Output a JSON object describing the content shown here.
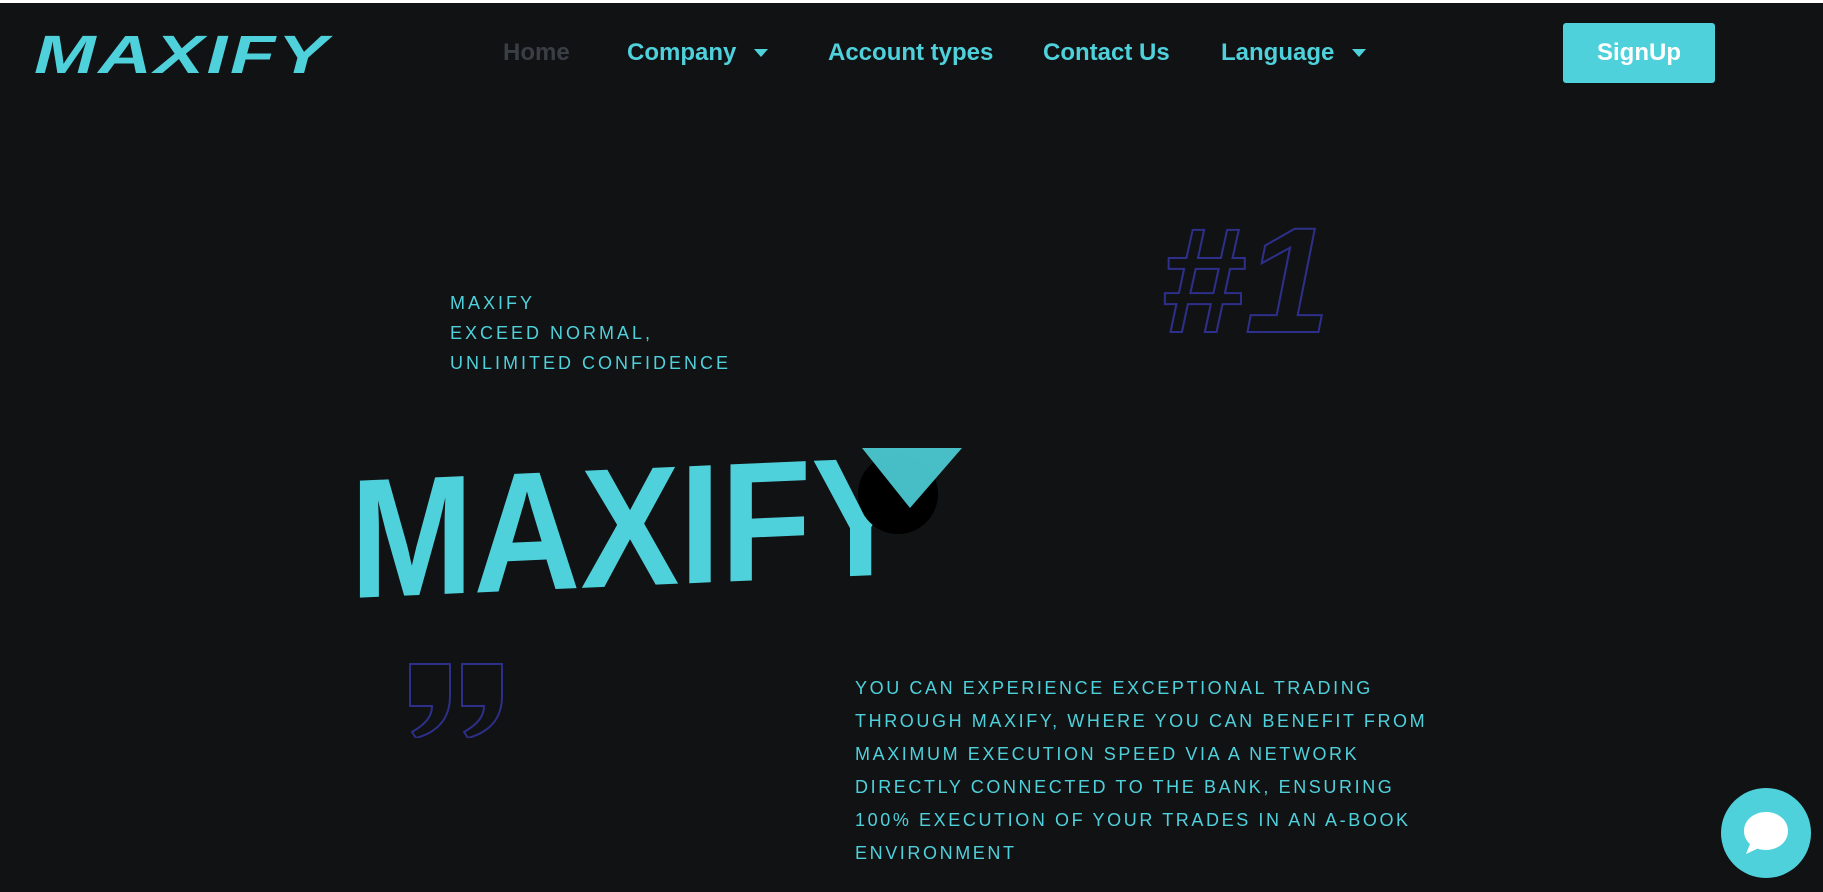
{
  "header": {
    "logo_text": "MAXIFY",
    "nav": [
      {
        "label": "Home",
        "active": true,
        "dropdown": false
      },
      {
        "label": "Company",
        "active": false,
        "dropdown": true
      },
      {
        "label": "Account types",
        "active": false,
        "dropdown": false
      },
      {
        "label": "Contact Us",
        "active": false,
        "dropdown": false
      },
      {
        "label": "Language",
        "active": false,
        "dropdown": true
      }
    ],
    "signup_label": "SignUp"
  },
  "hero": {
    "tagline": [
      "MAXIFY",
      "EXCEED NORMAL,",
      "UNLIMITED CONFIDENCE"
    ],
    "rank_badge": "#1",
    "big_logo_text": "MAXIFY",
    "description": "YOU CAN EXPERIENCE EXCEPTIONAL TRADING THROUGH MAXIFY, WHERE YOU CAN BENEFIT FROM MAXIMUM EXECUTION SPEED VIA A NETWORK DIRECTLY CONNECTED TO THE BANK, ENSURING 100% EXECUTION OF YOUR TRADES IN AN A-BOOK ENVIRONMENT"
  },
  "icons": {
    "chat": "chat-bubble-icon",
    "quote": "quote-icon",
    "caret": "chevron-down-icon"
  },
  "colors": {
    "background": "#111213",
    "accent": "#4fd1dc",
    "outline": "#2e2f8a",
    "home_inactive": "#3a3e46"
  }
}
